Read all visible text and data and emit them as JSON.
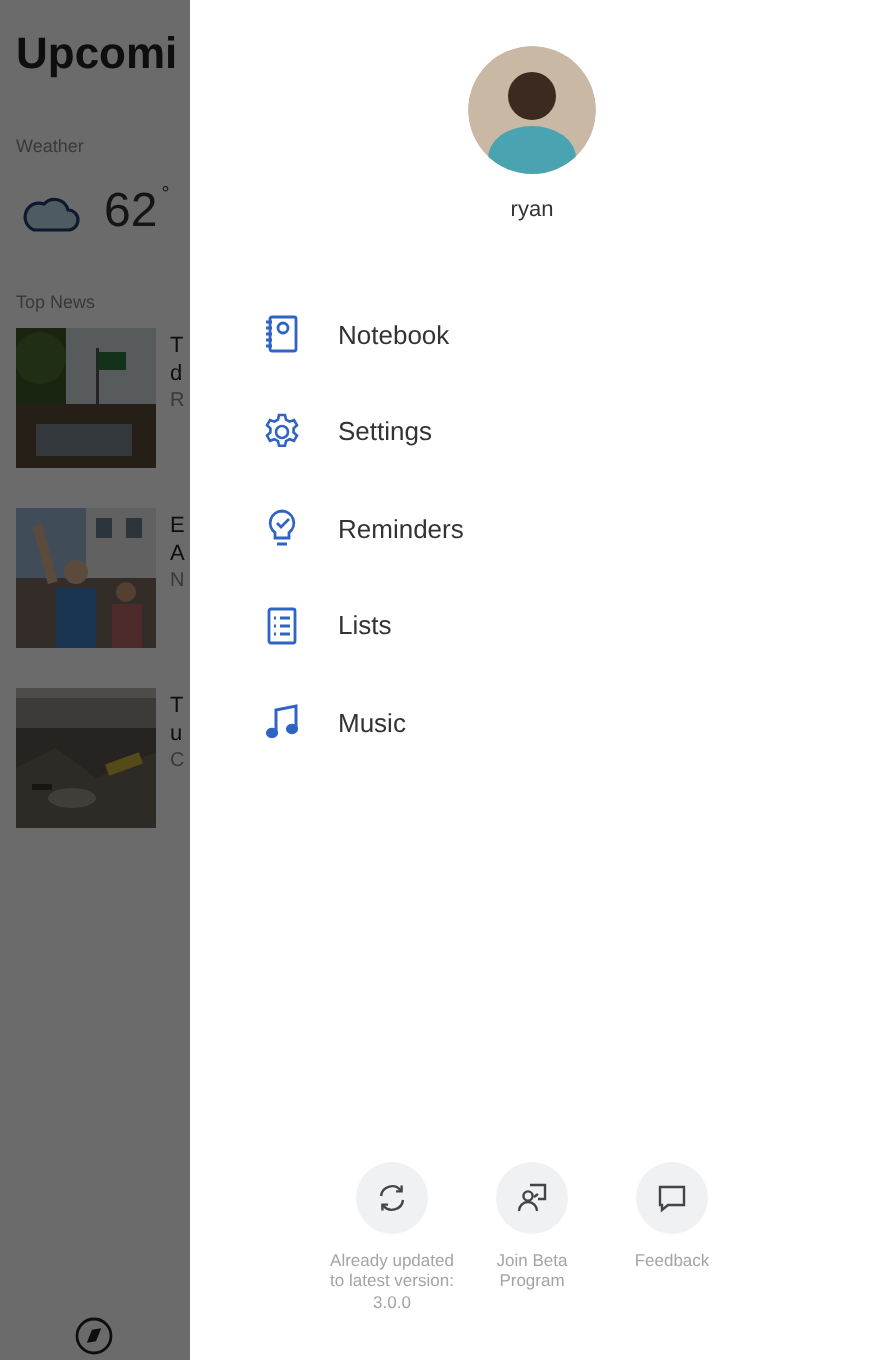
{
  "background_page": {
    "title": "Upcomi",
    "weather": {
      "label": "Weather",
      "temperature": "62",
      "unit": "°"
    },
    "top_news": {
      "label": "Top News",
      "items": [
        {
          "kind": "picture",
          "title": "T",
          "line_2": "d",
          "source": "R"
        },
        {
          "kind": "picture",
          "title": "E",
          "line_2": "A",
          "source": "N"
        },
        {
          "kind": "picture",
          "title": "T",
          "line_2": "u",
          "source": "C"
        }
      ]
    }
  },
  "drawer": {
    "user": {
      "name": "ryan"
    },
    "menu": [
      {
        "label": "Notebook",
        "kind": "notebook"
      },
      {
        "label": "Settings",
        "kind": "settings"
      },
      {
        "label": "Reminders",
        "kind": "reminders"
      },
      {
        "label": "Lists",
        "kind": "lists"
      },
      {
        "label": "Music",
        "kind": "music"
      }
    ],
    "actions": [
      {
        "label": "Already updated to latest version: 3.0.0",
        "kind": "update"
      },
      {
        "label": "Join Beta Program",
        "kind": "beta"
      },
      {
        "label": "Feedback",
        "kind": "feedback"
      }
    ]
  }
}
